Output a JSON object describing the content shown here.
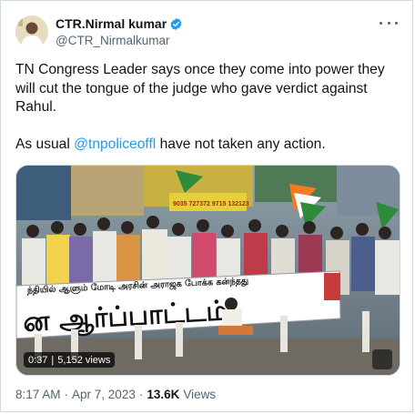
{
  "author": {
    "display_name": "CTR.Nirmal kumar",
    "handle": "@CTR_Nirmalkumar",
    "verified": true
  },
  "tweet": {
    "paragraph1": "TN Congress Leader says once they come into power they will cut the tongue of the judge who gave verdict against Rahul.",
    "paragraph2_prefix": "As usual ",
    "mention": "@tnpoliceoffl",
    "paragraph2_suffix": " have not  taken any action."
  },
  "media": {
    "type": "video",
    "duration": "0:37",
    "separator": "|",
    "views": "5,152 views",
    "banner_line1": "ந்தியில் ஆளும் மோடி அரசின் அராஜக போக்க கன்ந்தது",
    "banner_line2": "ன ஆர்ப்பாட்டம்",
    "sign_numbers": "9035 727372  9715 132123"
  },
  "meta": {
    "time": "8:17 AM",
    "date": "Apr 7, 2023",
    "views_count": "13.6K",
    "views_label": "Views",
    "separator": "·"
  },
  "colors": {
    "accent": "#1d9bf0",
    "secondary_text": "#536471",
    "border": "#cfd9de"
  },
  "icons": [
    "avatar",
    "verified-badge-icon",
    "more-icon",
    "gif-badge-icon"
  ]
}
